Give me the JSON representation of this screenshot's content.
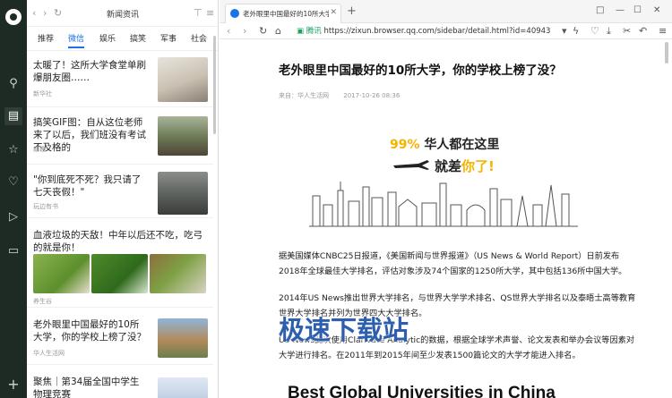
{
  "panel": {
    "title": "新闻资讯",
    "tabs": [
      "推荐",
      "微信",
      "娱乐",
      "搞笑",
      "军事",
      "社会"
    ],
    "active_tab": "微信",
    "items": [
      {
        "title": "太暖了！这所大学食堂单刷爆朋友圈……",
        "source": "新华社"
      },
      {
        "title": "搞笑GIF图：自从这位老师来了以后，我们班没有考试不及格的",
        "source": "新趣"
      },
      {
        "title": "\"你到底死不死？我只请了七天丧假！\"",
        "source": "玩边有书"
      },
      {
        "title": "血液垃圾的天敌！中年以后还不吃，吃弓的就是你！",
        "source": "养生谷"
      },
      {
        "title": "老外眼里中国最好的10所大学，你的学校上榜了没？",
        "source": "华人生活网"
      },
      {
        "title": "聚焦｜第34届全国中学生物理竞赛",
        "source": ""
      }
    ]
  },
  "browser": {
    "tab_title": "老外眼里中国最好的10所大学，你的学校上",
    "url_secure_label": "腾讯",
    "url": "https://zixun.browser.qq.com/sidebar/detail.html?id=40943",
    "window_controls": [
      "□",
      "—",
      "☐",
      "✕"
    ]
  },
  "article": {
    "title": "老外眼里中国最好的10所大学，你的学校上榜了没？",
    "source": "来自：华人生活网",
    "date": "2017-10-26 08:36",
    "banner_line1_highlight": "99%",
    "banner_line1_rest": " 华人都在这里",
    "banner_line2_plain": "就差",
    "banner_line2_highlight": "你了!",
    "paragraphs": [
      "据美国媒体CNBC25日报道，《美国新闻与世界报道》（US News & World Report）日前发布2018年全球最佳大学排名，评估对象涉及74个国家的1250所大学，其中包括136所中国大学。",
      "2014年US News推出世界大学排名，与世界大学学术排名、QS世界大学排名以及泰晤士高等教育世界大学排名并列为世界四大大学排名。",
      "US News此次使用Clarivate Analytic的数据，根据全球学术声誉、论文发表和举办会议等因素对大学进行排名。在2011年到2015年间至少发表1500篇论文的大学才能进入排名。"
    ],
    "subheading": "Best Global Universities in China"
  },
  "watermark": "极速下载站",
  "colors": {
    "rail": "#1e2a24",
    "accent": "#1a73e8",
    "highlight": "#f5b400",
    "secure": "#1aa260"
  },
  "icons": [
    "qq-logo-icon",
    "search-icon",
    "news-icon",
    "star-icon",
    "heart-icon",
    "play-icon",
    "video-icon",
    "add-icon"
  ]
}
